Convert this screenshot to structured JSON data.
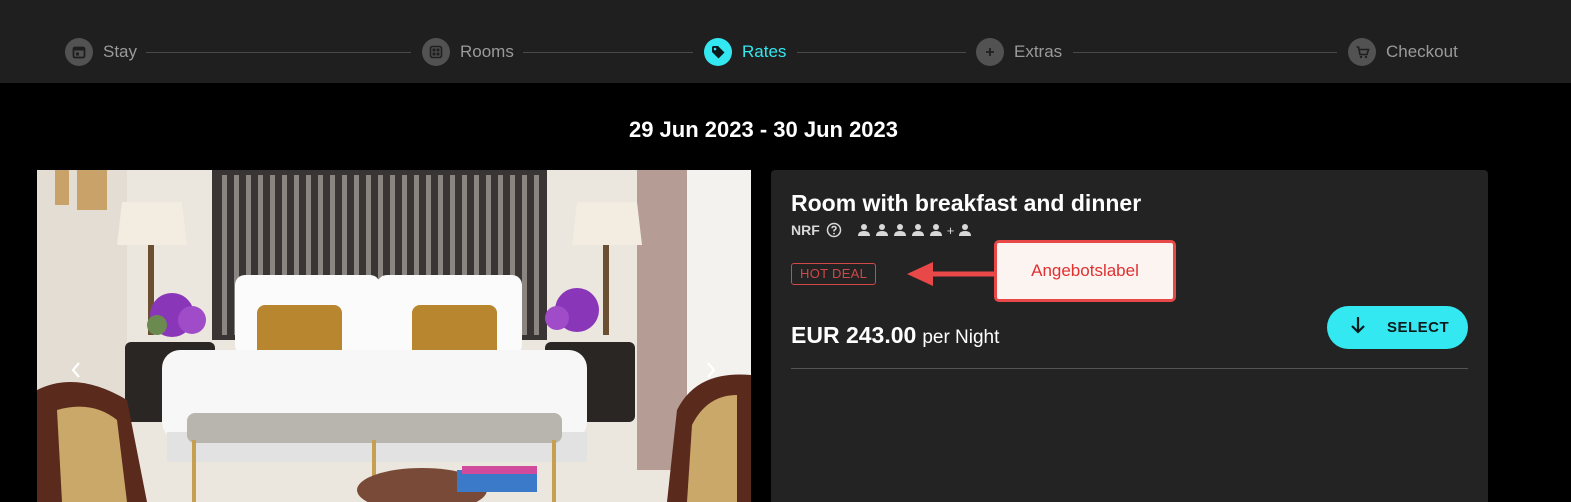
{
  "stepper": {
    "steps": [
      {
        "label": "Stay",
        "icon": "calendar-icon",
        "active": false
      },
      {
        "label": "Rooms",
        "icon": "grid-icon",
        "active": false
      },
      {
        "label": "Rates",
        "icon": "tag-icon",
        "active": true
      },
      {
        "label": "Extras",
        "icon": "plus-icon",
        "active": false
      },
      {
        "label": "Checkout",
        "icon": "cart-icon",
        "active": false
      }
    ]
  },
  "date_range": "29 Jun 2023 - 30 Jun 2023",
  "gallery": {
    "prev_icon": "chevron-left-icon",
    "next_icon": "chevron-right-icon"
  },
  "rate": {
    "title": "Room with breakfast and dinner",
    "code": "NRF",
    "occupancy_plus": "+",
    "badge": "HOT DEAL",
    "price": "EUR 243.00",
    "price_unit": "per Night",
    "select_label": "SELECT"
  },
  "annotation": {
    "label": "Angebotslabel"
  },
  "colors": {
    "accent": "#33e8f0",
    "badge": "#d04848",
    "annotation": "#e84848",
    "stepper_bg": "#1f1f1f",
    "card_bg": "#232323"
  }
}
